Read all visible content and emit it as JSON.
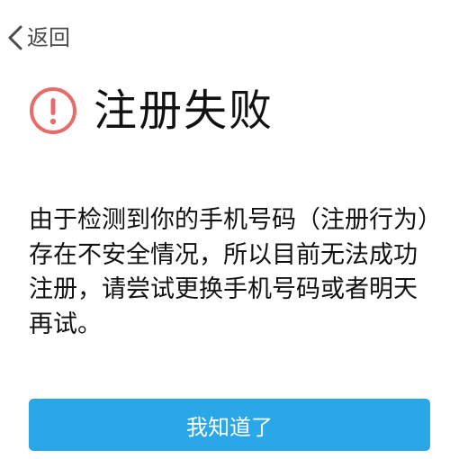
{
  "header": {
    "back_icon": "chevron-left-icon",
    "back_label": "返回"
  },
  "result": {
    "icon": "exclamation-circle-icon",
    "title": "注册失败",
    "message": "由于检测到你的手机号码（注册行为）存在不安全情况，所以目前无法成功注册，请尝试更换手机号码或者明天再试。"
  },
  "actions": {
    "confirm_label": "我知道了"
  },
  "colors": {
    "accent": "#2aa7e8",
    "alert": "#e86b6b",
    "text": "#111111"
  }
}
